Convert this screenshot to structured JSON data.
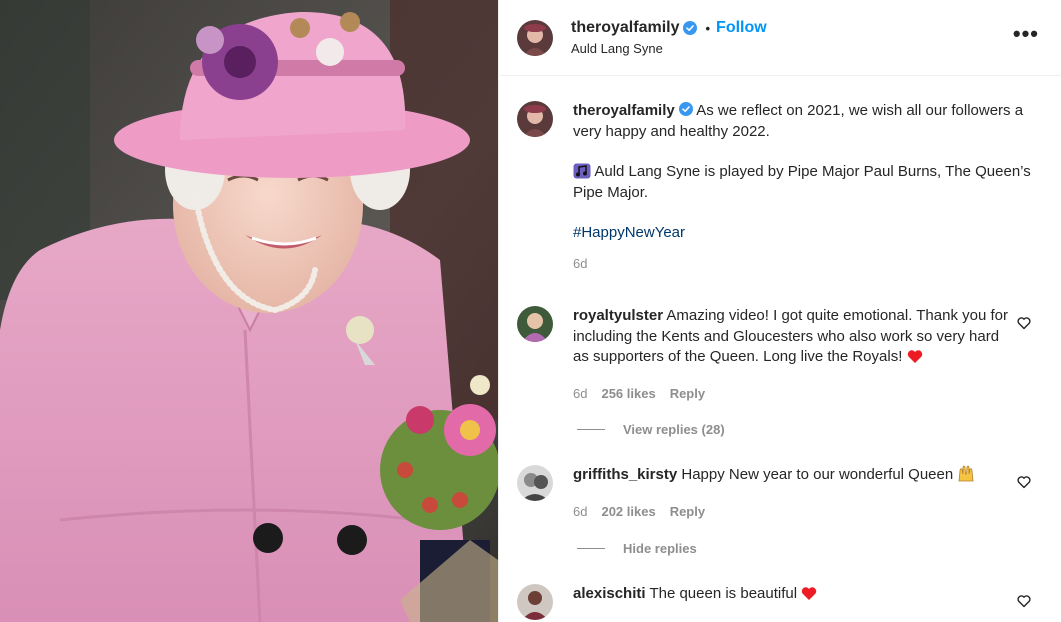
{
  "post": {
    "username": "theroyalfamily",
    "follow_label": "Follow",
    "audio": "Auld Lang Syne",
    "more_label": "•••"
  },
  "caption": {
    "username": "theroyalfamily",
    "p1": "As we reflect on 2021, we wish all our followers a very happy and healthy 2022.",
    "p2": "Auld Lang Syne is played by Pipe Major Paul Burns, The Queen’s Pipe Major.",
    "hashtag": "#HappyNewYear",
    "time": "6d"
  },
  "comments": [
    {
      "username": "royaltyulster",
      "text": "Amazing video! I got quite emotional. Thank you for including the Kents and Gloucesters who also work so very hard as supporters of the Queen. Long live the Royals!",
      "time": "6d",
      "likes": "256 likes",
      "reply": "Reply",
      "replies_toggle": "View replies (28)"
    },
    {
      "username": "griffiths_kirsty",
      "text": "Happy New year to our wonderful Queen",
      "time": "6d",
      "likes": "202 likes",
      "reply": "Reply",
      "replies_toggle": "Hide replies"
    },
    {
      "username": "alexischiti",
      "text": "The queen is beautiful"
    }
  ],
  "colors": {
    "accent": "#0095f6",
    "verified": "#3897f0",
    "heart_red": "#ed1c24",
    "muted": "#8e8e8e",
    "hashtag": "#00376b",
    "coat_pink": "#e9a9c9"
  },
  "icons": {
    "verified": "verified-badge-icon",
    "more": "more-options-icon",
    "like": "heart-outline-icon",
    "music": "musical-notes-emoji",
    "heart": "red-heart-emoji",
    "hands": "raising-hands-emoji"
  }
}
